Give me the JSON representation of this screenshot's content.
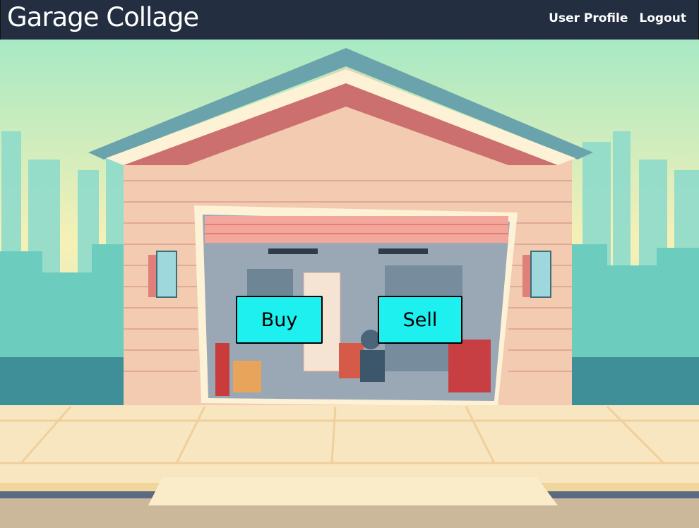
{
  "navbar": {
    "brand": "Garage Collage",
    "links": [
      "User Profile",
      "Logout"
    ]
  },
  "actions": {
    "buy_label": "Buy",
    "sell_label": "Sell"
  },
  "colors": {
    "navbar_bg": "#232f40",
    "button_bg": "#1ef0ef",
    "sky_top": "#a7e9c4",
    "sky_bottom": "#f6f0b6"
  },
  "illustration": {
    "subject": "garage-illustration"
  }
}
